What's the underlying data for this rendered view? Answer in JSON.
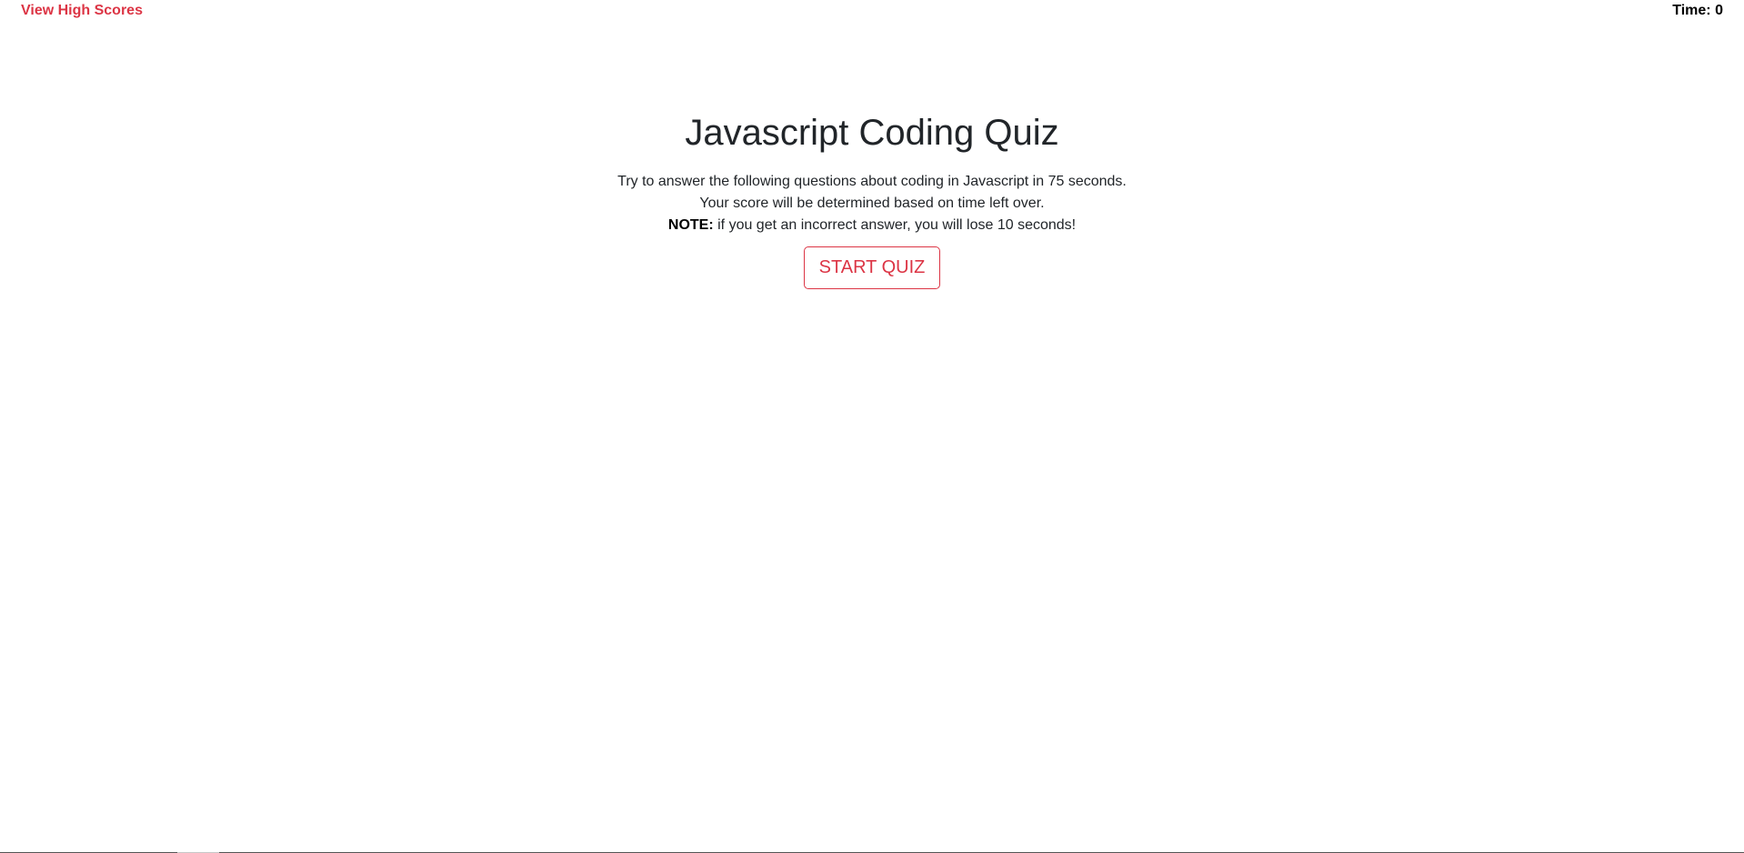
{
  "header": {
    "high_scores_label": "View High Scores",
    "time_label": "Time:",
    "time_value": "0"
  },
  "intro": {
    "title": "Javascript Coding Quiz",
    "line1": "Try to answer the following questions about coding in Javascript in 75 seconds.",
    "line2": "Your score will be determined based on time left over.",
    "note_label": "NOTE:",
    "note_text": " if you get an incorrect answer, you will lose 10 seconds!",
    "start_button_label": "START QUIZ"
  },
  "colors": {
    "accent": "#dc3545",
    "text": "#212529",
    "background": "#ffffff"
  }
}
